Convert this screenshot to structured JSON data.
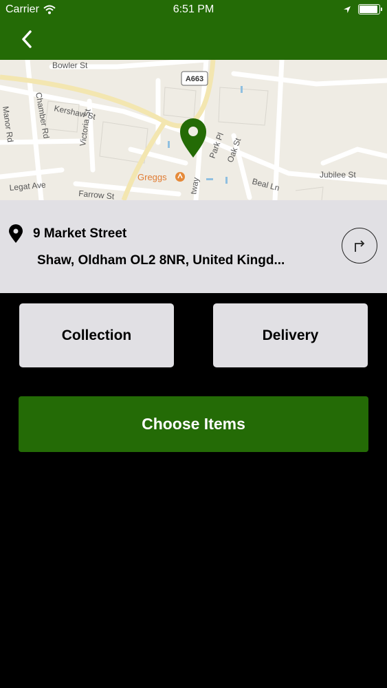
{
  "status_bar": {
    "carrier": "Carrier",
    "time": "6:51 PM",
    "battery_level": 0.92
  },
  "map": {
    "streets": [
      "Bowler St",
      "Kershaw St",
      "Chamber Rd",
      "Manor Rd",
      "Victoria St",
      "Park Pl",
      "Oak St",
      "Beal Ln",
      "Jubilee St",
      "Farrow St",
      "Legat Ave"
    ],
    "road_badge": "A663",
    "poi": "Greggs"
  },
  "address": {
    "line1": "9 Market Street",
    "line2": "Shaw, Oldham OL2 8NR, United Kingd..."
  },
  "buttons": {
    "collection": "Collection",
    "delivery": "Delivery",
    "choose_items": "Choose Items"
  },
  "colors": {
    "brand_green": "#246b06",
    "panel_gray": "#e1e0e4",
    "background": "#000000"
  }
}
